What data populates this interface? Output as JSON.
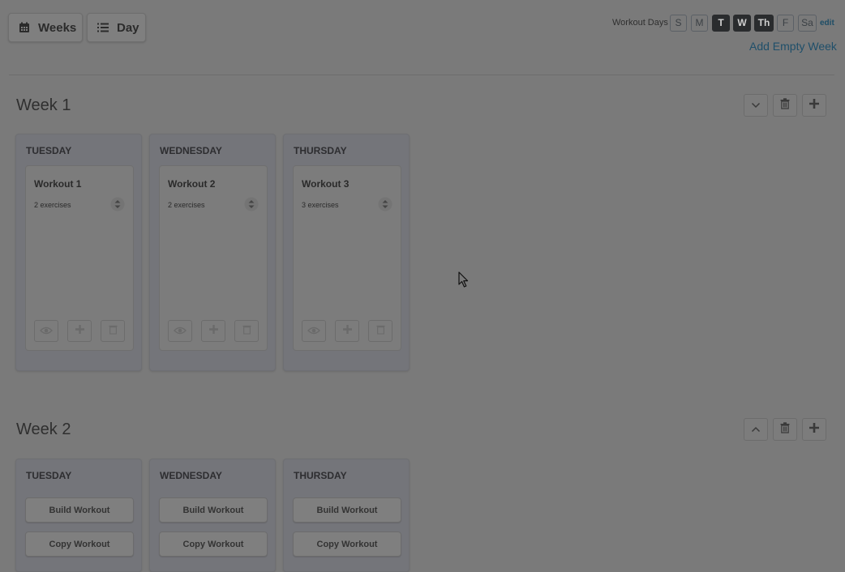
{
  "toolbar": {
    "weeks_label": "Weeks",
    "day_label": "Day",
    "weeks_icon": "calendar-icon",
    "day_icon": "list-icon"
  },
  "workout_days": {
    "label": "Workout Days",
    "days": [
      {
        "label": "S",
        "active": false
      },
      {
        "label": "M",
        "active": false
      },
      {
        "label": "T",
        "active": true
      },
      {
        "label": "W",
        "active": true
      },
      {
        "label": "Th",
        "active": true
      },
      {
        "label": "F",
        "active": false
      },
      {
        "label": "Sa",
        "active": false
      }
    ],
    "edit_label": "edit",
    "add_week_label": "Add Empty Week"
  },
  "weeks": [
    {
      "title": "Week 1",
      "toggle_icon": "chevron-down-icon",
      "days": [
        {
          "name": "TUESDAY",
          "workout": {
            "title": "Workout 1",
            "exercises": "2 exercises"
          }
        },
        {
          "name": "WEDNESDAY",
          "workout": {
            "title": "Workout 2",
            "exercises": "2 exercises"
          }
        },
        {
          "name": "THURSDAY",
          "workout": {
            "title": "Workout 3",
            "exercises": "3 exercises"
          }
        }
      ]
    },
    {
      "title": "Week 2",
      "toggle_icon": "chevron-up-icon",
      "days": [
        {
          "name": "TUESDAY",
          "build_label": "Build Workout",
          "copy_label": "Copy Workout"
        },
        {
          "name": "WEDNESDAY",
          "build_label": "Build Workout",
          "copy_label": "Copy Workout"
        },
        {
          "name": "THURSDAY",
          "build_label": "Build Workout",
          "copy_label": "Copy Workout"
        }
      ]
    }
  ],
  "colors": {
    "overlay_bg": "#7a7a7a",
    "active_day": "#2a2c2e",
    "link": "#1f4f6a"
  }
}
